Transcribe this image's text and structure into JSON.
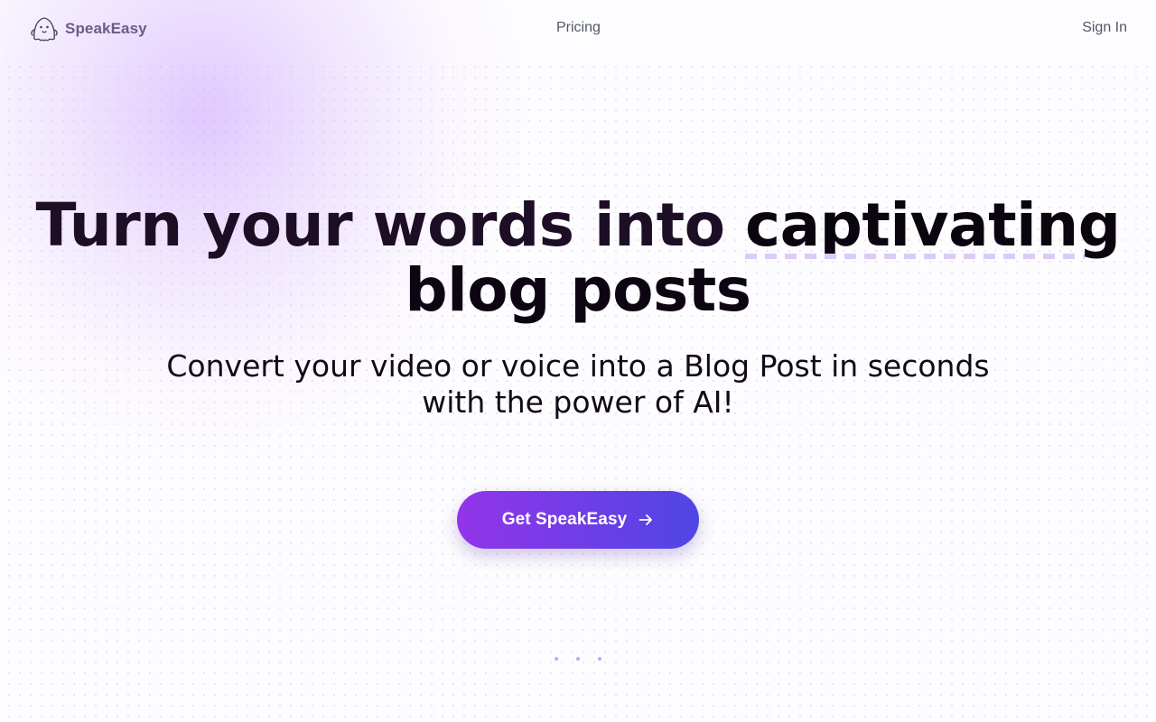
{
  "nav": {
    "brand_name": "SpeakEasy",
    "brand_icon": "ghost-icon",
    "links": [
      {
        "label": "Pricing"
      },
      {
        "label": "Sign In"
      }
    ]
  },
  "hero": {
    "headline_part1": "Turn your words into ",
    "headline_highlight": "captivating",
    "headline_line2": "blog posts",
    "subheadline_line1": "Convert your video or voice into a Blog Post in seconds",
    "subheadline_line2": "with the power of AI!",
    "cta_label": "Get SpeakEasy",
    "cta_icon": "arrow-right-icon"
  },
  "colors": {
    "accent_start": "#9334ea",
    "accent_end": "#4f46e5",
    "brand_text": "#6b5b8a",
    "highlight_underline": "#dccbf7"
  }
}
